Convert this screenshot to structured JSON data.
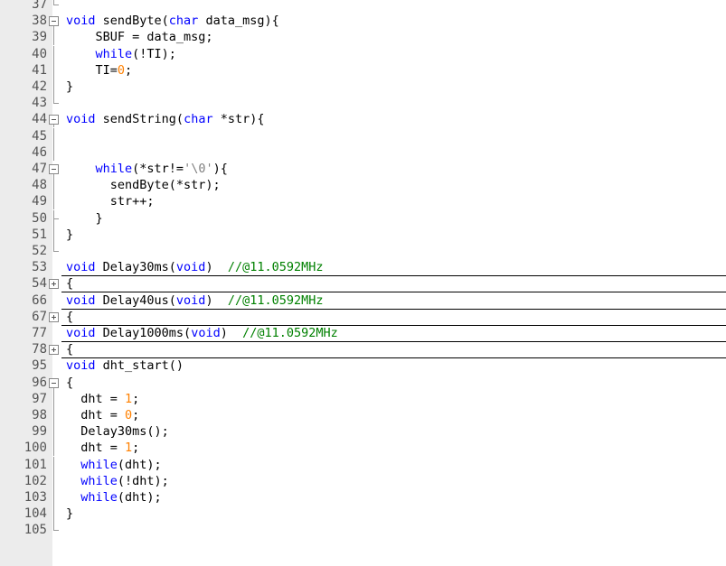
{
  "editor": {
    "language": "C",
    "colors": {
      "keyword": "#0000ff",
      "comment": "#008000",
      "string": "#808080",
      "number": "#ff8000",
      "text": "#000000"
    },
    "lines": [
      {
        "n": "37",
        "fold": "end",
        "segs": []
      },
      {
        "n": "38",
        "fold": "open",
        "segs": [
          [
            "kw",
            "void"
          ],
          [
            "t",
            " sendByte("
          ],
          [
            "kw",
            "char"
          ],
          [
            "t",
            " data_msg){"
          ]
        ]
      },
      {
        "n": "39",
        "fold": "line",
        "segs": [
          [
            "t",
            "    SBUF = data_msg;"
          ]
        ]
      },
      {
        "n": "40",
        "fold": "line",
        "segs": [
          [
            "t",
            "    "
          ],
          [
            "kw",
            "while"
          ],
          [
            "t",
            "(!TI);"
          ]
        ]
      },
      {
        "n": "41",
        "fold": "line",
        "segs": [
          [
            "t",
            "    TI="
          ],
          [
            "nm",
            "0"
          ],
          [
            "t",
            ";"
          ]
        ]
      },
      {
        "n": "42",
        "fold": "line",
        "segs": [
          [
            "t",
            "}"
          ]
        ]
      },
      {
        "n": "43",
        "fold": "end",
        "segs": []
      },
      {
        "n": "44",
        "fold": "open",
        "segs": [
          [
            "kw",
            "void"
          ],
          [
            "t",
            " sendString("
          ],
          [
            "kw",
            "char"
          ],
          [
            "t",
            " *str){"
          ]
        ]
      },
      {
        "n": "45",
        "fold": "line",
        "segs": []
      },
      {
        "n": "46",
        "fold": "line",
        "segs": []
      },
      {
        "n": "47",
        "fold": "open",
        "segs": [
          [
            "t",
            "    "
          ],
          [
            "kw",
            "while"
          ],
          [
            "t",
            "(*str!="
          ],
          [
            "str",
            "'\\0'"
          ],
          [
            "t",
            "){"
          ]
        ]
      },
      {
        "n": "48",
        "fold": "line",
        "segs": [
          [
            "t",
            "      sendByte(*str);"
          ]
        ]
      },
      {
        "n": "49",
        "fold": "line",
        "segs": [
          [
            "t",
            "      str++;"
          ]
        ]
      },
      {
        "n": "50",
        "fold": "mid",
        "segs": [
          [
            "t",
            "    }"
          ]
        ]
      },
      {
        "n": "51",
        "fold": "line",
        "segs": [
          [
            "t",
            "}"
          ]
        ]
      },
      {
        "n": "52",
        "fold": "end",
        "segs": []
      },
      {
        "n": "53",
        "fold": "",
        "segs": [
          [
            "kw",
            "void"
          ],
          [
            "t",
            " Delay30ms("
          ],
          [
            "kw",
            "void"
          ],
          [
            "t",
            ")  "
          ],
          [
            "cm",
            "//@11.0592MHz"
          ]
        ]
      },
      {
        "n": "54",
        "fold": "closed",
        "sep": true,
        "segs": [
          [
            "t",
            "{"
          ]
        ]
      },
      {
        "n": "66",
        "fold": "",
        "segs": [
          [
            "kw",
            "void"
          ],
          [
            "t",
            " Delay40us("
          ],
          [
            "kw",
            "void"
          ],
          [
            "t",
            ")  "
          ],
          [
            "cm",
            "//@11.0592MHz"
          ]
        ]
      },
      {
        "n": "67",
        "fold": "closed",
        "sep": true,
        "segs": [
          [
            "t",
            "{"
          ]
        ]
      },
      {
        "n": "77",
        "fold": "",
        "segs": [
          [
            "kw",
            "void"
          ],
          [
            "t",
            " Delay1000ms("
          ],
          [
            "kw",
            "void"
          ],
          [
            "t",
            ")  "
          ],
          [
            "cm",
            "//@11.0592MHz"
          ]
        ]
      },
      {
        "n": "78",
        "fold": "closed",
        "sep": true,
        "segs": [
          [
            "t",
            "{"
          ]
        ]
      },
      {
        "n": "95",
        "fold": "",
        "segs": [
          [
            "kw",
            "void"
          ],
          [
            "t",
            " dht_start()"
          ]
        ]
      },
      {
        "n": "96",
        "fold": "open",
        "segs": [
          [
            "t",
            "{"
          ]
        ]
      },
      {
        "n": "97",
        "fold": "line",
        "segs": [
          [
            "t",
            "  dht = "
          ],
          [
            "nm",
            "1"
          ],
          [
            "t",
            ";"
          ]
        ]
      },
      {
        "n": "98",
        "fold": "line",
        "segs": [
          [
            "t",
            "  dht = "
          ],
          [
            "nm",
            "0"
          ],
          [
            "t",
            ";"
          ]
        ]
      },
      {
        "n": "99",
        "fold": "line",
        "segs": [
          [
            "t",
            "  Delay30ms();"
          ]
        ]
      },
      {
        "n": "100",
        "fold": "line",
        "segs": [
          [
            "t",
            "  dht = "
          ],
          [
            "nm",
            "1"
          ],
          [
            "t",
            ";"
          ]
        ]
      },
      {
        "n": "101",
        "fold": "line",
        "segs": [
          [
            "t",
            "  "
          ],
          [
            "kw",
            "while"
          ],
          [
            "t",
            "(dht);"
          ]
        ]
      },
      {
        "n": "102",
        "fold": "line",
        "segs": [
          [
            "t",
            "  "
          ],
          [
            "kw",
            "while"
          ],
          [
            "t",
            "(!dht);"
          ]
        ]
      },
      {
        "n": "103",
        "fold": "line",
        "segs": [
          [
            "t",
            "  "
          ],
          [
            "kw",
            "while"
          ],
          [
            "t",
            "(dht);"
          ]
        ]
      },
      {
        "n": "104",
        "fold": "line",
        "segs": [
          [
            "t",
            "}"
          ]
        ]
      },
      {
        "n": "105",
        "fold": "end",
        "segs": []
      }
    ]
  }
}
